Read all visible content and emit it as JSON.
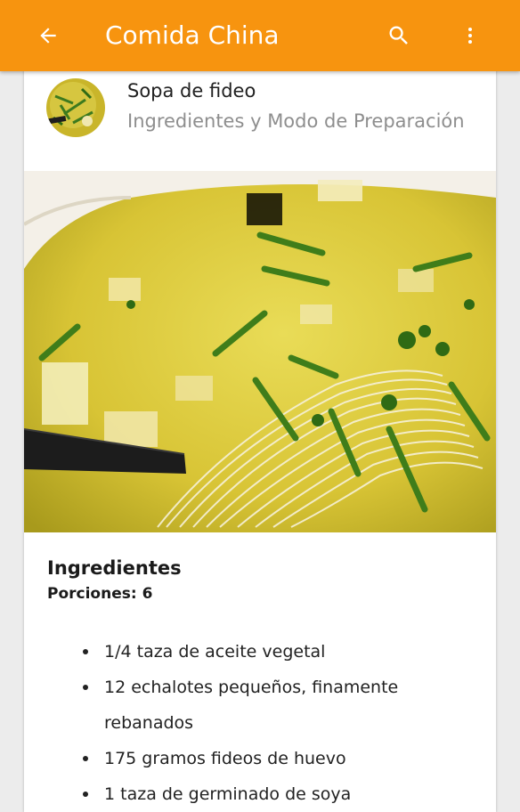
{
  "colors": {
    "appbar": "#f7940f",
    "appbar_text": "#ffffff",
    "subtitle_gray": "#8e8e8e"
  },
  "appbar": {
    "title": "Comida China",
    "back_icon": "arrow-back-icon",
    "search_icon": "search-icon",
    "more_icon": "more-vert-icon"
  },
  "recipe": {
    "title": "Sopa de fideo",
    "subtitle": "Ingredientes y Modo de Preparación",
    "ingredients_heading": "Ingredientes",
    "portions": "Porciones: 6",
    "ingredients": [
      "1/4 taza de aceite vegetal",
      "12 echalotes pequeños, finamente rebanados",
      "175 gramos fideos de huevo",
      "1 taza de germinado de soya"
    ]
  }
}
